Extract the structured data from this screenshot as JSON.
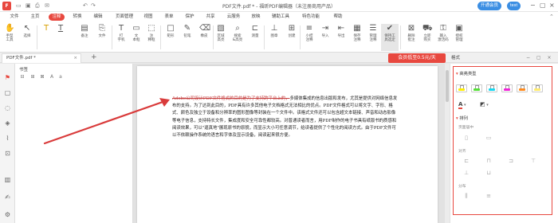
{
  "window": {
    "title": "PDF文件.pdf * - 福昕PDF编辑器（未注册商用产品）",
    "vip_button": "开通会员",
    "user_badge": "test",
    "logo_letter": "F"
  },
  "menu": {
    "tabs": [
      "文件",
      "主页",
      "注释",
      "转换",
      "编辑",
      "页面管理",
      "视图",
      "表单",
      "保护",
      "共享",
      "云服务",
      "放映",
      "辅助工具",
      "特色功能",
      "帮助"
    ],
    "active_tab": "注释"
  },
  "ribbon": {
    "tools": [
      {
        "label": "手型\n工具",
        "icon": "hand-icon"
      },
      {
        "label": "选择",
        "icon": "cursor-icon"
      },
      {
        "label": "",
        "icon": "highlight-icon"
      },
      {
        "label": "",
        "icon": "underline-icon"
      },
      {
        "label": "备注",
        "icon": "note-icon"
      },
      {
        "label": "文件",
        "icon": "file-attach-icon"
      },
      {
        "label": "打\n字机",
        "icon": "typewriter-icon"
      },
      {
        "label": "文\n本框",
        "icon": "textbox-icon"
      },
      {
        "label": "注\n释框",
        "icon": "callout-icon"
      },
      {
        "label": "矩形",
        "icon": "rectangle-icon"
      },
      {
        "label": "铅笔",
        "icon": "pencil-icon"
      },
      {
        "label": "橡皮",
        "icon": "eraser-icon"
      },
      {
        "label": "区域\n高亮",
        "icon": "area-highlight-icon"
      },
      {
        "label": "搜索\n&高亮",
        "icon": "search-highlight-icon"
      },
      {
        "label": "测量",
        "icon": "measure-icon"
      },
      {
        "label": "图章",
        "icon": "stamp-icon"
      },
      {
        "label": "创建",
        "icon": "create-icon"
      },
      {
        "label": "小结\n注释",
        "icon": "summary-icon"
      },
      {
        "label": "导入",
        "icon": "import-icon"
      },
      {
        "label": "导出",
        "icon": "export-icon"
      },
      {
        "label": "保存\n注释",
        "icon": "save-comments-icon"
      },
      {
        "label": "管理\n注释",
        "icon": "manage-comments-icon"
      },
      {
        "label": "保持工\n具选定",
        "icon": "keep-tool-icon"
      },
      {
        "label": "删除\n批注",
        "icon": "delete-annot-icon"
      },
      {
        "label": "立即\n购买",
        "icon": "cart-icon"
      },
      {
        "label": "输入\n激活码",
        "icon": "key-icon"
      },
      {
        "label": "授权\n管理",
        "icon": "license-icon"
      }
    ]
  },
  "tabbar": {
    "doc_tab": "PDF文件.pdf *",
    "close_glyph": "×",
    "add_glyph": "+",
    "promo": "会员低至0.5元/天",
    "right_tab": "格式",
    "right_controls": "− ▢ ×"
  },
  "bookmarks": {
    "title": "书签"
  },
  "document": {
    "strike_text": "Adobe公司设计PDF文件格式的目的是为了支持跨平台上的，",
    "body_text": "多媒体集成的信息出版和发布，尤其是提供对网络信息发布的支持。为了达到此目的，PDF具有许多其他电子文档格式无法相比的优点。PDF文件格式可以将文字、字形、格式、颜色及独立于设备和分辨率的图形图像等封装在一个文件中。该格式文件还可以包含超文本链接、声音和动态影像等电子信息，支持特长文件，集成度和安全可靠性都较高。对普通读者而言，用PDF制作的电子书具有纸版书的质感和阅读效果，可以\"逼真地\"展现原书的原貌，而显示大小可任意调节，给读者提供了个性化的阅读方式。由于PDF文件可以不依赖操作系统的语言和字体及显示设备，阅读起来很方便。"
  },
  "format_panel": {
    "section_highlight": "高亮类型",
    "swatch_colors": [
      "#ffee00",
      "#55e036",
      "#14d7f0",
      "#f021d8",
      "#ff8a1c",
      "#ffeb6b"
    ],
    "section_arrange": "排列",
    "sub_distribute_page": "页面居中",
    "sub_align": "对齐",
    "sub_distribute": "分布"
  },
  "arrow": {
    "color": "#d93b3b"
  }
}
